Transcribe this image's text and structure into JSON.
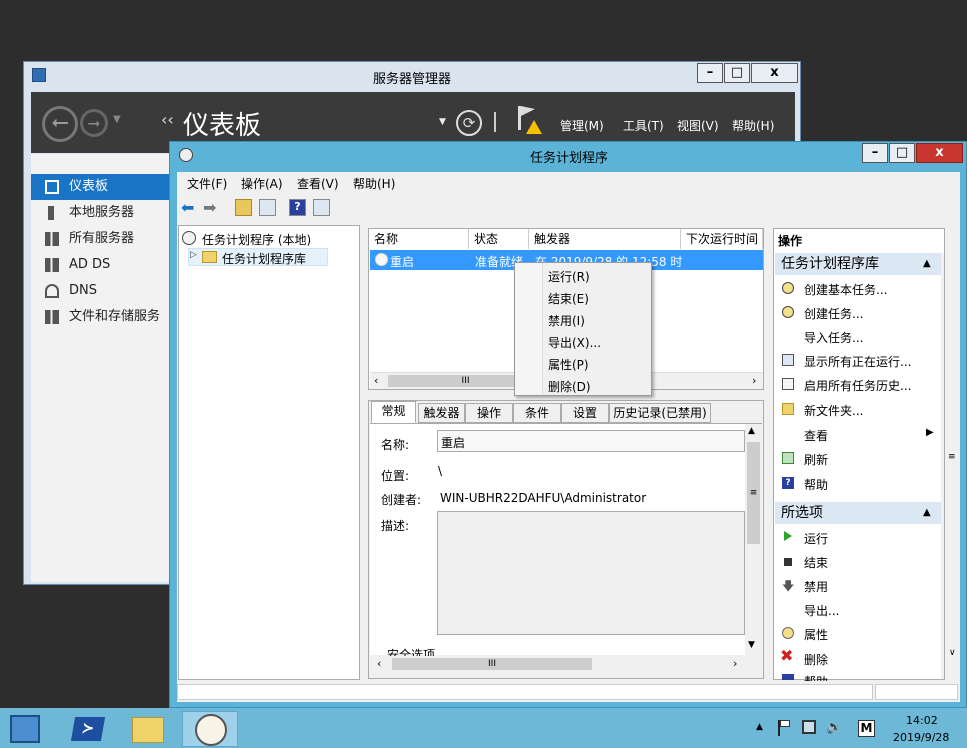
{
  "server_manager": {
    "title": "服务器管理器",
    "header_title": "仪表板",
    "menus": [
      "管理(M)",
      "工具(T)",
      "视图(V)",
      "帮助(H)"
    ],
    "nav": [
      "仪表板",
      "本地服务器",
      "所有服务器",
      "AD DS",
      "DNS",
      "文件和存储服务"
    ]
  },
  "task_scheduler": {
    "title": "任务计划程序",
    "menus": [
      "文件(F)",
      "操作(A)",
      "查看(V)",
      "帮助(H)"
    ],
    "tree": {
      "root": "任务计划程序 (本地)",
      "child": "任务计划程序库"
    },
    "columns": [
      "名称",
      "状态",
      "触发器",
      "下次运行时间"
    ],
    "selected_task": {
      "name": "重启",
      "status": "准备就绪",
      "trigger": "在 2019/9/28 的 12:58 时"
    },
    "context_menu": [
      "运行(R)",
      "结束(E)",
      "禁用(I)",
      "导出(X)...",
      "属性(P)",
      "删除(D)"
    ],
    "tabs": [
      "常规",
      "触发器",
      "操作",
      "条件",
      "设置",
      "历史记录(已禁用)"
    ],
    "general": {
      "name_label": "名称:",
      "name_value": "重启",
      "location_label": "位置:",
      "location_value": "\\",
      "author_label": "创建者:",
      "author_value": "WIN-UBHR22DAHFU\\Administrator",
      "desc_label": "描述:",
      "security_label": "安全选项"
    },
    "actions_header": "操作",
    "library_section": "任务计划程序库",
    "library_actions": [
      "创建基本任务...",
      "创建任务...",
      "导入任务...",
      "显示所有正在运行...",
      "启用所有任务历史...",
      "新文件夹...",
      "查看",
      "刷新",
      "帮助"
    ],
    "selected_section": "所选项",
    "selected_actions": [
      "运行",
      "结束",
      "禁用",
      "导出...",
      "属性",
      "删除",
      "帮助"
    ]
  },
  "taskbar": {
    "time": "14:02",
    "date": "2019/9/28",
    "ime": "M"
  }
}
